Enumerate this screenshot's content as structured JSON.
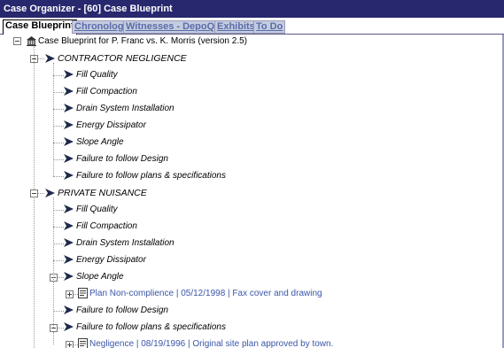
{
  "window": {
    "title": "Case Organizer - [60] Case Blueprint"
  },
  "tabs": [
    {
      "label": "Case Blueprint",
      "active": true
    },
    {
      "label": "Chronology",
      "active": false
    },
    {
      "label": "Witnesses - DepoQ's",
      "active": false
    },
    {
      "label": "Exhibits",
      "active": false
    },
    {
      "label": "To Do",
      "active": false
    }
  ],
  "tree": {
    "root": {
      "label": "Case Blueprint for P. Franc vs. K. Morris (version 2.5)",
      "icon": "building-icon"
    },
    "issues": [
      {
        "label": "CONTRACTOR NEGLIGENCE",
        "items": [
          {
            "label": "Fill Quality"
          },
          {
            "label": "Fill Compaction"
          },
          {
            "label": "Drain System Installation"
          },
          {
            "label": "Energy Dissipator"
          },
          {
            "label": "Slope Angle"
          },
          {
            "label": "Failure to follow Design"
          },
          {
            "label": "Failure to follow plans & specifications"
          }
        ]
      },
      {
        "label": "PRIVATE NUISANCE",
        "items": [
          {
            "label": "Fill Quality"
          },
          {
            "label": "Fill Compaction"
          },
          {
            "label": "Drain System Installation"
          },
          {
            "label": "Energy Dissipator"
          },
          {
            "label": "Slope Angle",
            "doc": "Plan Non-complience | 05/12/1998 | Fax cover and drawing"
          },
          {
            "label": "Failure to follow Design"
          },
          {
            "label": "Failure to follow plans & specifications",
            "doc": "Negligence | 08/19/1996 | Original site plan approved by town."
          }
        ]
      }
    ]
  },
  "colors": {
    "titlebar": "#28286e",
    "tab_inactive": "#c4cde0",
    "link": "#3a56a8"
  }
}
